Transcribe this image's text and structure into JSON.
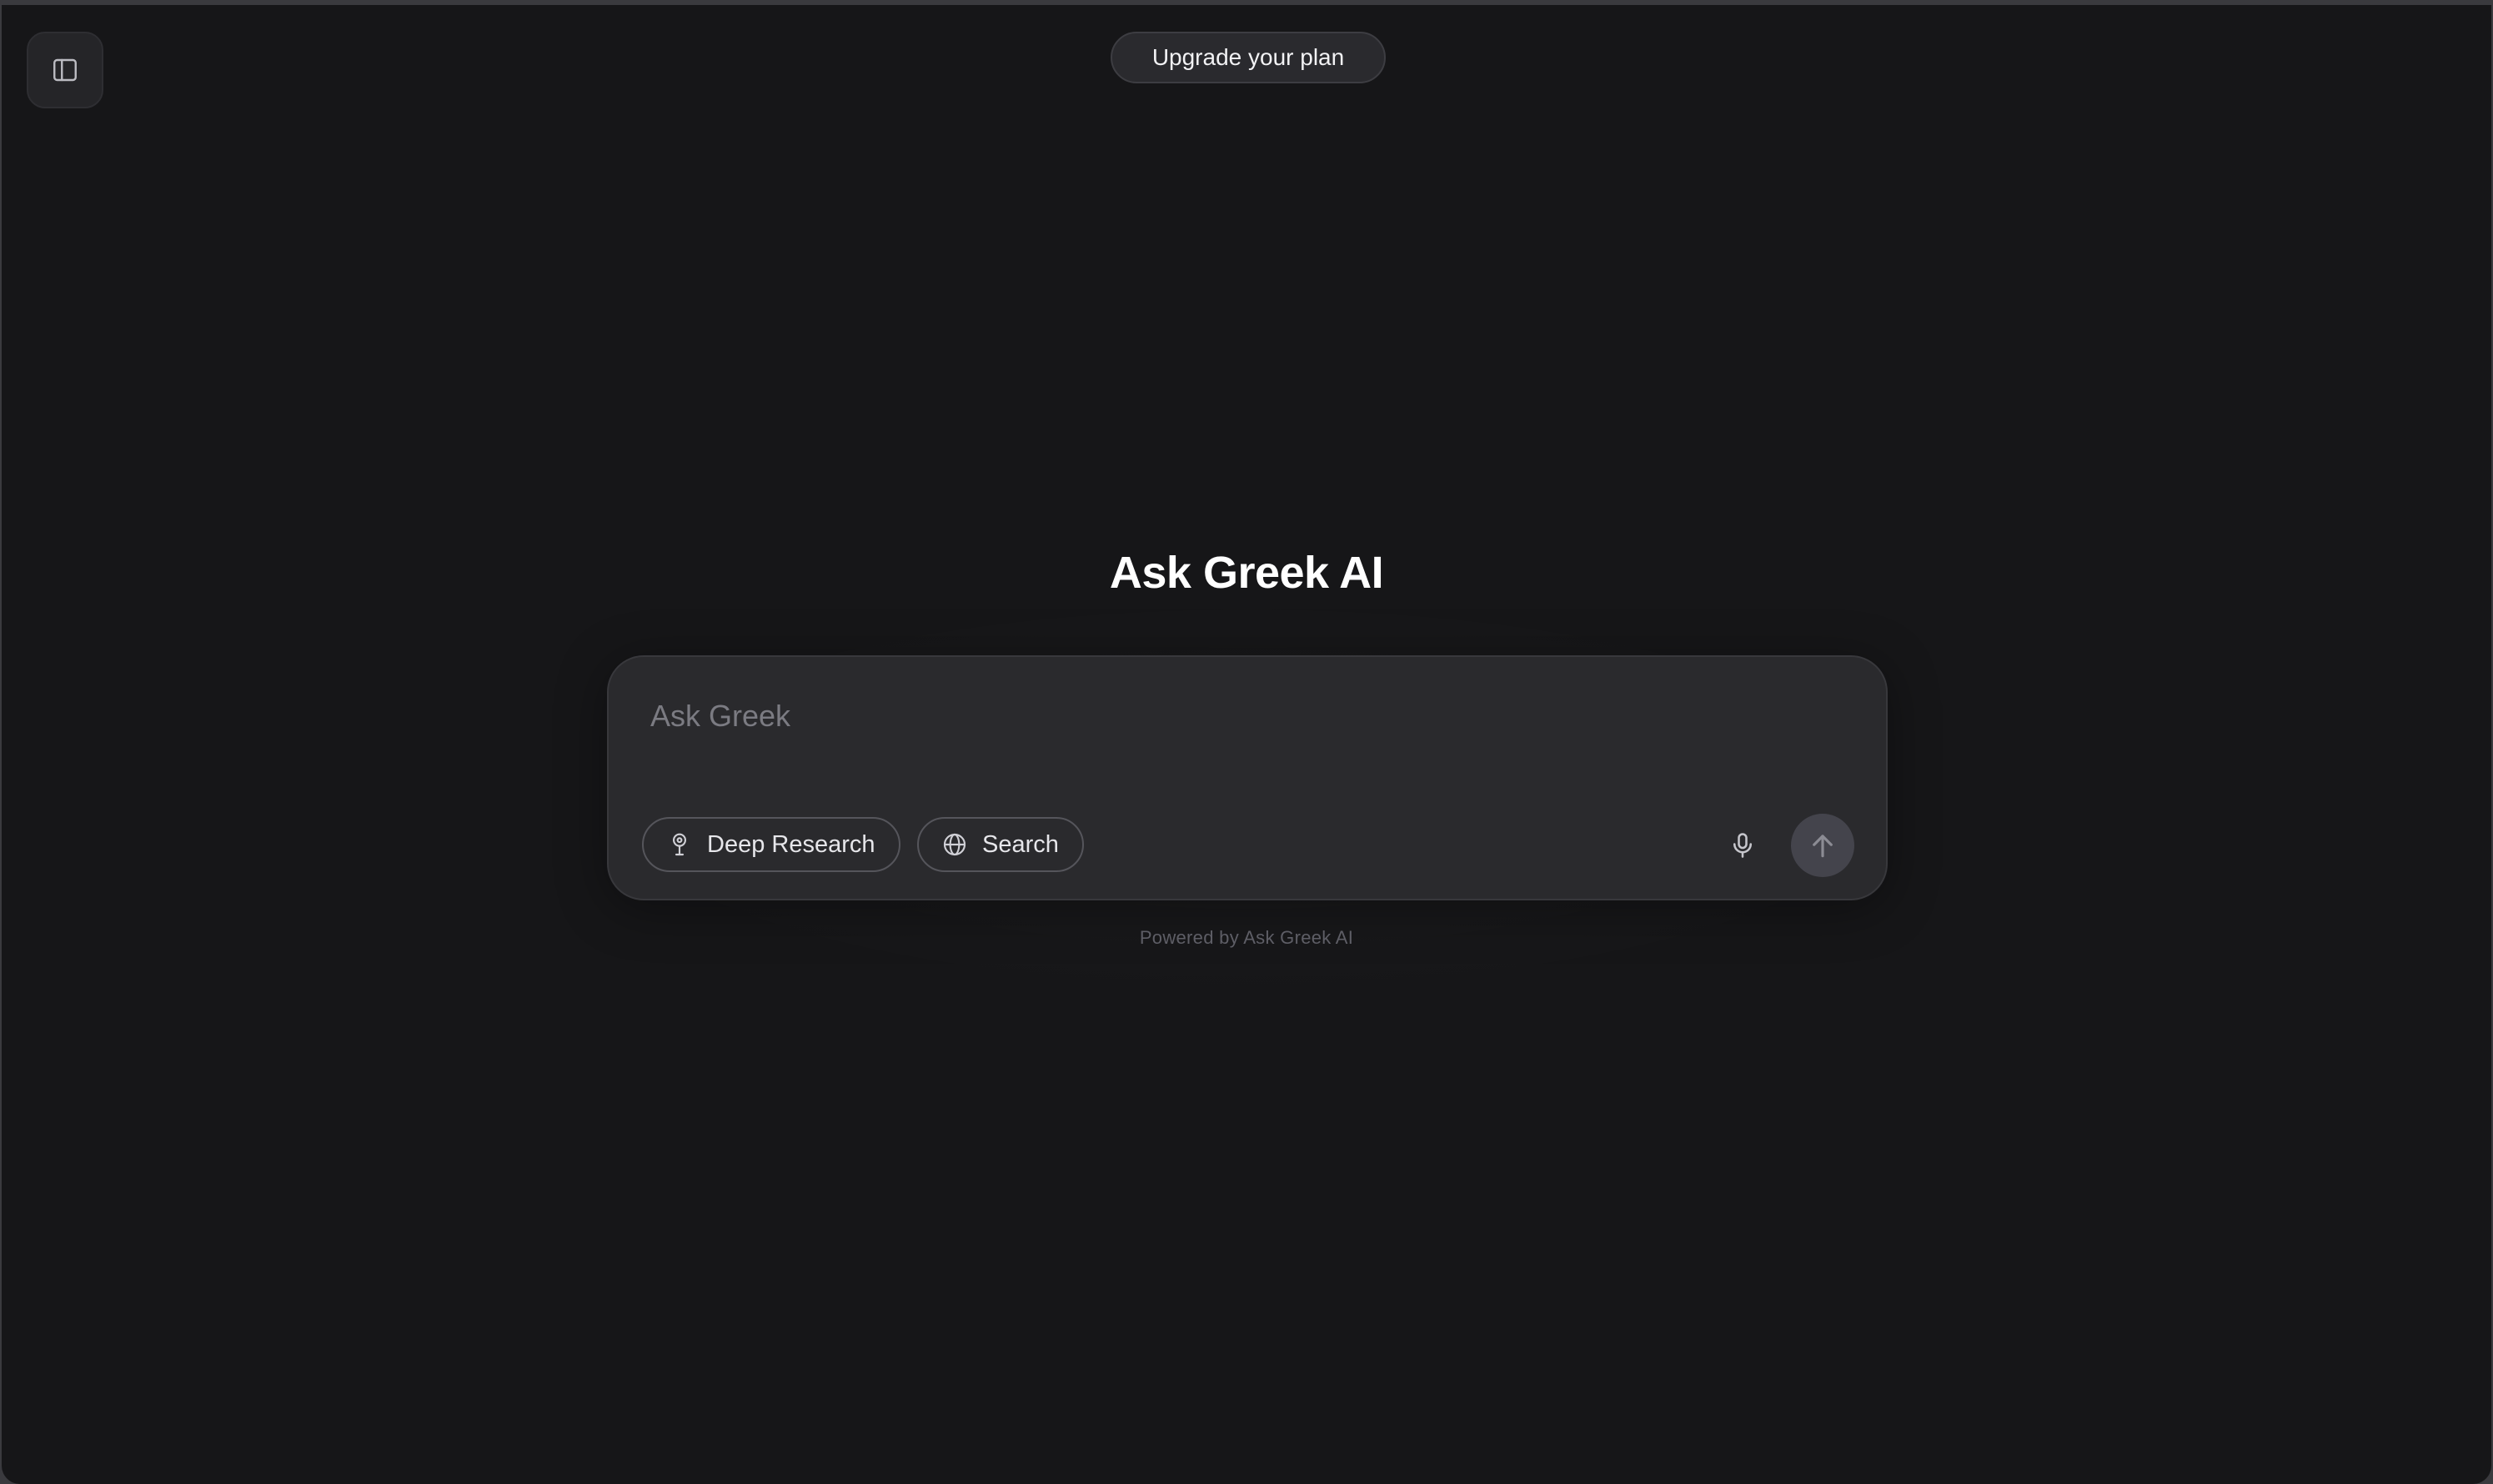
{
  "header": {
    "upgrade_label": "Upgrade your plan"
  },
  "main": {
    "title": "Ask Greek AI",
    "composer": {
      "placeholder": "Ask Greek",
      "value": "",
      "chips": [
        {
          "label": "Deep Research",
          "icon": "deep-research-icon"
        },
        {
          "label": "Search",
          "icon": "globe-icon"
        }
      ]
    },
    "footer_note": "Powered by Ask Greek AI"
  },
  "icons": {
    "sidebar_toggle": "sidebar-toggle-icon",
    "mic": "microphone-icon",
    "send": "arrow-up-icon"
  },
  "colors": {
    "background": "#161618",
    "composer": "#2a2a2d",
    "send_button": "#44444c",
    "text_primary": "#ffffff",
    "placeholder": "#7b7b82"
  }
}
